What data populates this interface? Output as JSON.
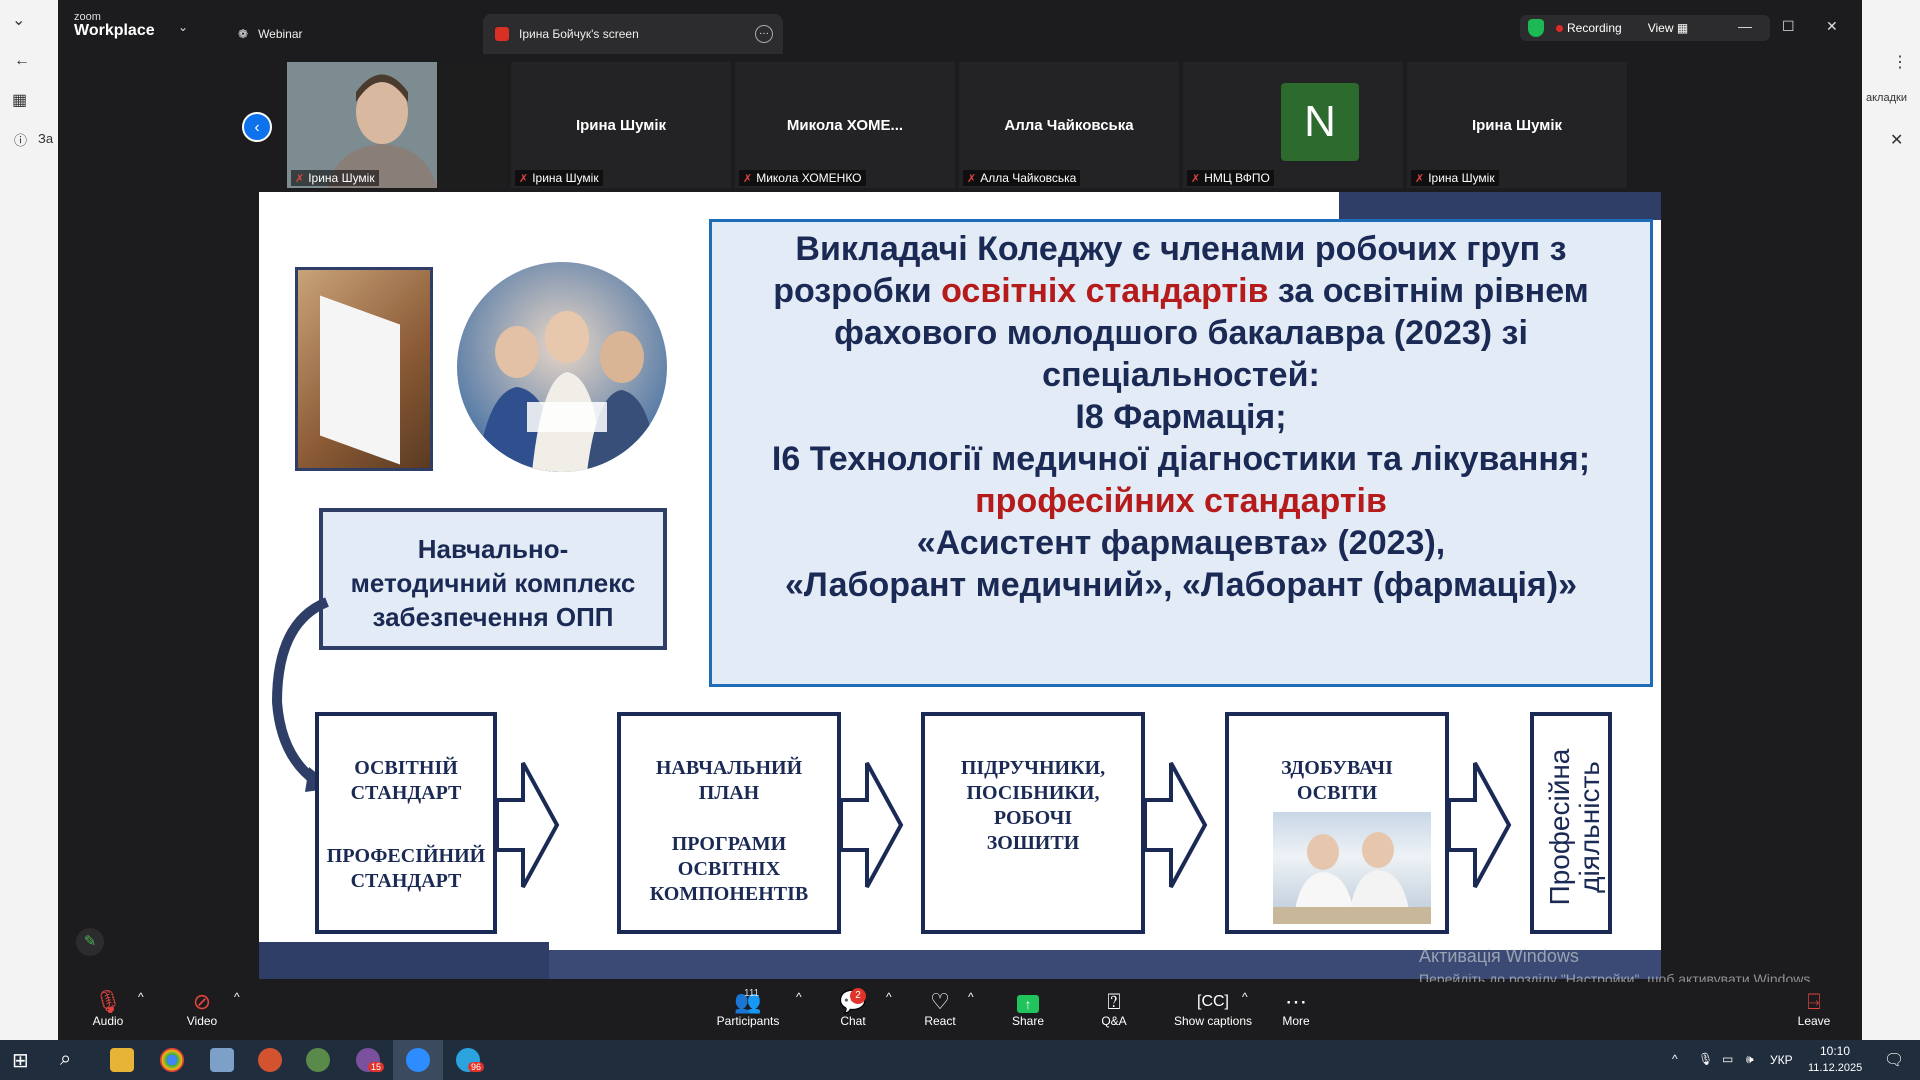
{
  "zoom": {
    "brand_small": "zoom",
    "brand_big": "Workplace",
    "tab_webinar": "Webinar",
    "tab_screen": "Ірина Бойчук's screen",
    "recording": "Recording",
    "view": "View"
  },
  "participants": [
    {
      "name": "",
      "label": "Ірина Шумік"
    },
    {
      "name": "Ірина Шумік",
      "label": "Ірина Шумік"
    },
    {
      "name": "Микола ХОМЕ...",
      "label": "Микола ХОМЕНКО"
    },
    {
      "name": "Алла Чайковська",
      "label": "Алла Чайковська"
    },
    {
      "name": "",
      "label": "НМЦ ВФПО",
      "avatar": "N"
    },
    {
      "name": "Ірина Шумік",
      "label": "Ірина Шумік"
    }
  ],
  "slide": {
    "main_line1": "Викладачі Коледжу є членами робочих груп з",
    "main_line2a": "розробки ",
    "main_line2b": "освітніх стандартів",
    "main_line2c": " за освітнім рівнем",
    "main_line3": "фахового молодшого бакалавра (2023) зі",
    "main_line4": "спеціальностей:",
    "main_line5": "І8 Фармація;",
    "main_line6": "І6 Технології медичної діагностики та лікування;",
    "main_line7": "професійних стандартів",
    "main_line8": "«Асистент фармацевта» (2023),",
    "main_line9": "«Лаборант медичний», «Лаборант (фармація)»",
    "side_box": [
      "Навчально-",
      "методичний комплекс",
      "забезпечення ОПП"
    ],
    "flow": [
      {
        "l1": "ОСВІТНІЙ",
        "l2": "СТАНДАРТ",
        "l3": "ПРОФЕСІЙНИЙ",
        "l4": "СТАНДАРТ"
      },
      {
        "l1": "НАВЧАЛЬНИЙ",
        "l2": "ПЛАН",
        "l3": "ПРОГРАМИ",
        "l4": "ОСВІТНІХ",
        "l5": "КОМПОНЕНТІВ"
      },
      {
        "l1": "ПІДРУЧНИКИ,",
        "l2": "ПОСІБНИКИ,",
        "l3": "РОБОЧІ",
        "l4": "ЗОШИТИ"
      },
      {
        "l1": "ЗДОБУВАЧІ",
        "l2": "ОСВІТИ"
      }
    ],
    "vertical_l1": "Професійна",
    "vertical_l2": "діяльність"
  },
  "watermark": {
    "line1": "Активація Windows",
    "line2": "Перейдіть до розділу \"Настройки\", щоб активувати Windows."
  },
  "toolbar": {
    "audio": "Audio",
    "video": "Video",
    "participants": "Participants",
    "participants_count": "111",
    "chat": "Chat",
    "chat_badge": "2",
    "react": "React",
    "share": "Share",
    "qa": "Q&A",
    "captions": "Show captions",
    "more": "More",
    "leave": "Leave"
  },
  "background_browser": {
    "tab_fragment": "За",
    "bookmarks_fragment": "акладки"
  },
  "taskbar": {
    "lang": "УКР",
    "time": "10:10",
    "date": "11.12.2025",
    "viber_badge": "15",
    "telegram_badge": "96"
  }
}
